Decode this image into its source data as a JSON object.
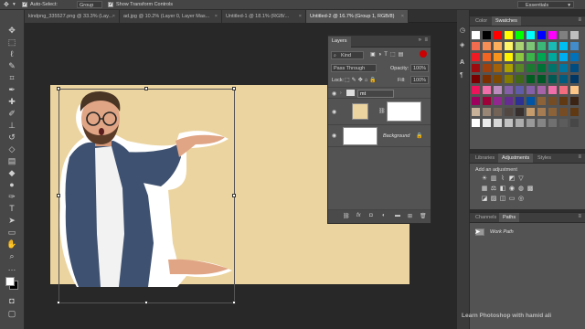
{
  "options_bar": {
    "auto_select_label": "Auto-Select:",
    "auto_select_value": "Group",
    "transform_controls_label": "Show Transform Controls",
    "workspace": "Essentials"
  },
  "tabs": [
    {
      "label": "kindpng_335527.png @ 33.3% (Lay...",
      "active": false
    },
    {
      "label": "ad.jpg @ 10.2% (Layer 0, Layer Mas...",
      "active": false
    },
    {
      "label": "Untitled-1 @ 18.1% (RGB/...",
      "active": false
    },
    {
      "label": "Untitled-2 @ 16.7% (Group 1, RGB/8)",
      "active": true
    }
  ],
  "tab_close_glyph": "×",
  "layers_panel": {
    "title": "Layers",
    "filter_kind": "Kind",
    "blend_mode": "Pass Through",
    "opacity_label": "Opacity:",
    "opacity_value": "100%",
    "lock_label": "Lock:",
    "fill_label": "Fill:",
    "fill_value": "100%",
    "layers": [
      {
        "name": "mt",
        "type": "group"
      },
      {
        "name": "",
        "type": "masked-image"
      },
      {
        "name": "Background",
        "type": "background"
      }
    ],
    "footer_icons": [
      "link-icon",
      "fx-icon",
      "mask-icon",
      "adjustment-icon",
      "folder-icon",
      "new-layer-icon",
      "trash-icon"
    ]
  },
  "color_panel": {
    "tabs": [
      "Color",
      "Swatches"
    ],
    "active_tab": "Swatches"
  },
  "adjustments_panel": {
    "tabs": [
      "Libraries",
      "Adjustments",
      "Styles"
    ],
    "active_tab": "Adjustments",
    "heading": "Add an adjustment"
  },
  "paths_panel": {
    "tabs": [
      "Channels",
      "Paths"
    ],
    "active_tab": "Paths",
    "item": "Work Path"
  },
  "watermark": "Learn Photoshop with hamid ali",
  "swatch_colors": [
    "#ffffff",
    "#000000",
    "#ff0000",
    "#ffff00",
    "#00ff00",
    "#00ffff",
    "#0000ff",
    "#ff00ff",
    "#808080",
    "#c0c0c0",
    "#f26c4f",
    "#f68e56",
    "#fbaf5d",
    "#fff568",
    "#acd373",
    "#7cc576",
    "#3bb878",
    "#1abbb4",
    "#00bff3",
    "#438ccb",
    "#ed1c24",
    "#f26522",
    "#f7941d",
    "#fff200",
    "#8dc63f",
    "#39b54a",
    "#00a651",
    "#00a99d",
    "#00aeef",
    "#0072bc",
    "#9e0b0f",
    "#a0410d",
    "#a3620a",
    "#aba000",
    "#598527",
    "#1a7b30",
    "#007236",
    "#00746b",
    "#0076a3",
    "#004b80",
    "#790000",
    "#7b2e00",
    "#7d4900",
    "#827b00",
    "#406618",
    "#005e20",
    "#005826",
    "#005952",
    "#005b7f",
    "#003663",
    "#ed145b",
    "#f06eaa",
    "#bd8cbf",
    "#8560a8",
    "#605ca8",
    "#855fa8",
    "#a763a8",
    "#f06ea9",
    "#f26d7d",
    "#fdc689",
    "#9e005d",
    "#9e0039",
    "#92278f",
    "#662d91",
    "#2e3192",
    "#0054a6",
    "#8c6239",
    "#754c24",
    "#603913",
    "#3c2415",
    "#c7b299",
    "#998675",
    "#736357",
    "#534741",
    "#362f2d",
    "#c69c6d",
    "#a67c52",
    "#8c6239",
    "#754c24",
    "#603913",
    "#ffffff",
    "#ebebeb",
    "#d6d6d6",
    "#c2c2c2",
    "#adadad",
    "#999999",
    "#858585",
    "#707070",
    "#5c5c5c",
    "#474747"
  ]
}
